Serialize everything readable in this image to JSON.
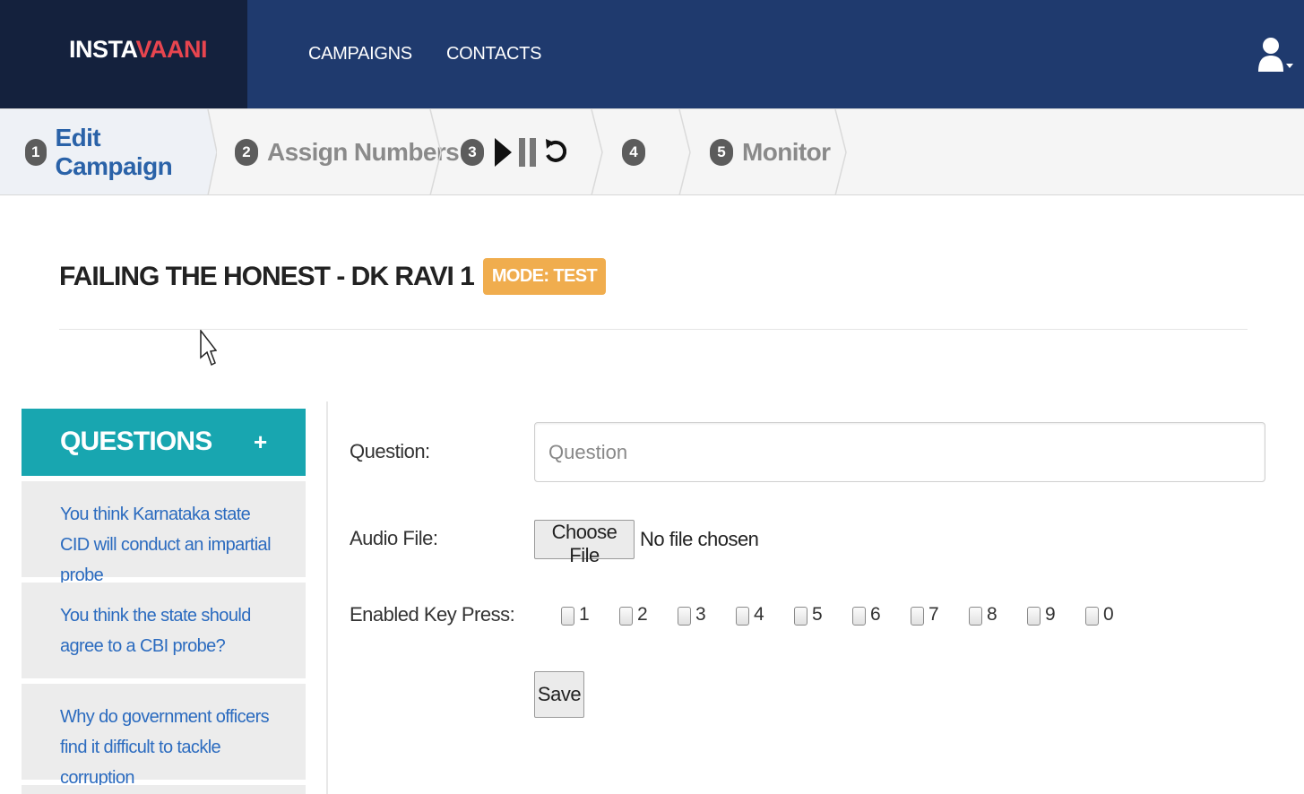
{
  "app": {
    "brand_part1": "INSTA",
    "brand_part2": "VAANI",
    "brand_color": "#e8454f",
    "navbar_color": "#1f3a6e"
  },
  "nav": {
    "campaigns": "CAMPAIGNS",
    "contacts": "CONTACTS",
    "user_icon": "user-icon"
  },
  "wizard": {
    "steps": [
      {
        "num": "1",
        "label": "Edit Campaign",
        "active": true
      },
      {
        "num": "2",
        "label": "Assign Numbers",
        "active": false
      },
      {
        "num": "3",
        "label": "",
        "icons": [
          "play-icon",
          "pause-icon",
          "reset-icon"
        ],
        "active": false
      },
      {
        "num": "4",
        "label": "",
        "active": false
      },
      {
        "num": "5",
        "label": "Monitor",
        "active": false
      }
    ]
  },
  "campaign": {
    "title": "FAILING THE HONEST - DK RAVI 1",
    "mode_badge": "MODE: TEST",
    "badge_color": "#f0ad4e"
  },
  "questions": {
    "header": "QUESTIONS",
    "add": "+",
    "items": [
      {
        "text": "You think Karnataka state CID will conduct an impartial probe"
      },
      {
        "text": "You think the state should agree to a CBI probe?"
      },
      {
        "text": "Why do government officers find it difficult to tackle corruption"
      }
    ]
  },
  "form": {
    "question_label": "Question:",
    "question_placeholder": "Question",
    "question_value": "",
    "audio_label": "Audio File:",
    "choose_file": "Choose File",
    "no_file": "No file chosen",
    "keys_label": "Enabled Key Press:",
    "keys": [
      "1",
      "2",
      "3",
      "4",
      "5",
      "6",
      "7",
      "8",
      "9",
      "0"
    ],
    "save": "Save"
  }
}
